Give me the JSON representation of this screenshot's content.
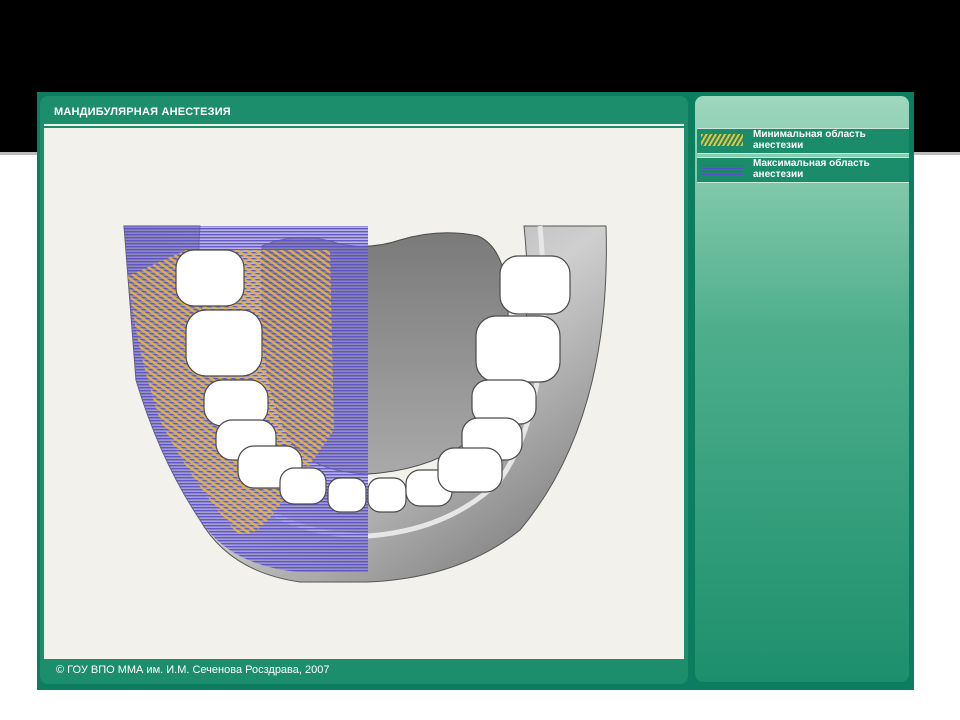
{
  "title": "МАНДИБУЛЯРНАЯ АНЕСТЕЗИЯ",
  "footer": "© ГОУ ВПО ММА им. И.М. Сеченова Росздрава, 2007",
  "legend": [
    {
      "label": "Минимальная область анестезии",
      "color": "#e9c33d"
    },
    {
      "label": "Максимальная область анестезии",
      "color": "#5a4fc8"
    }
  ]
}
